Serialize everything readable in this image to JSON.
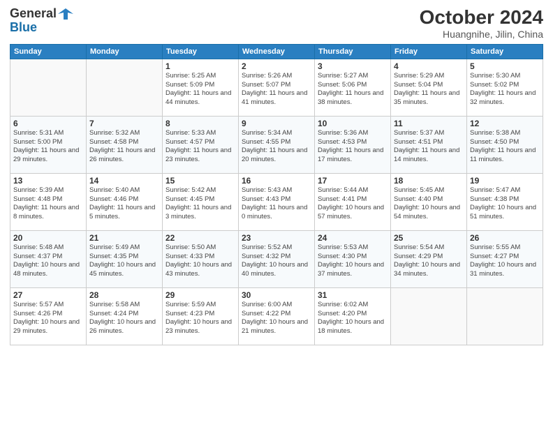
{
  "header": {
    "logo_general": "General",
    "logo_blue": "Blue",
    "month_title": "October 2024",
    "location": "Huangnihe, Jilin, China"
  },
  "weekdays": [
    "Sunday",
    "Monday",
    "Tuesday",
    "Wednesday",
    "Thursday",
    "Friday",
    "Saturday"
  ],
  "weeks": [
    [
      {
        "day": "",
        "info": ""
      },
      {
        "day": "",
        "info": ""
      },
      {
        "day": "1",
        "info": "Sunrise: 5:25 AM\nSunset: 5:09 PM\nDaylight: 11 hours and 44 minutes."
      },
      {
        "day": "2",
        "info": "Sunrise: 5:26 AM\nSunset: 5:07 PM\nDaylight: 11 hours and 41 minutes."
      },
      {
        "day": "3",
        "info": "Sunrise: 5:27 AM\nSunset: 5:06 PM\nDaylight: 11 hours and 38 minutes."
      },
      {
        "day": "4",
        "info": "Sunrise: 5:29 AM\nSunset: 5:04 PM\nDaylight: 11 hours and 35 minutes."
      },
      {
        "day": "5",
        "info": "Sunrise: 5:30 AM\nSunset: 5:02 PM\nDaylight: 11 hours and 32 minutes."
      }
    ],
    [
      {
        "day": "6",
        "info": "Sunrise: 5:31 AM\nSunset: 5:00 PM\nDaylight: 11 hours and 29 minutes."
      },
      {
        "day": "7",
        "info": "Sunrise: 5:32 AM\nSunset: 4:58 PM\nDaylight: 11 hours and 26 minutes."
      },
      {
        "day": "8",
        "info": "Sunrise: 5:33 AM\nSunset: 4:57 PM\nDaylight: 11 hours and 23 minutes."
      },
      {
        "day": "9",
        "info": "Sunrise: 5:34 AM\nSunset: 4:55 PM\nDaylight: 11 hours and 20 minutes."
      },
      {
        "day": "10",
        "info": "Sunrise: 5:36 AM\nSunset: 4:53 PM\nDaylight: 11 hours and 17 minutes."
      },
      {
        "day": "11",
        "info": "Sunrise: 5:37 AM\nSunset: 4:51 PM\nDaylight: 11 hours and 14 minutes."
      },
      {
        "day": "12",
        "info": "Sunrise: 5:38 AM\nSunset: 4:50 PM\nDaylight: 11 hours and 11 minutes."
      }
    ],
    [
      {
        "day": "13",
        "info": "Sunrise: 5:39 AM\nSunset: 4:48 PM\nDaylight: 11 hours and 8 minutes."
      },
      {
        "day": "14",
        "info": "Sunrise: 5:40 AM\nSunset: 4:46 PM\nDaylight: 11 hours and 5 minutes."
      },
      {
        "day": "15",
        "info": "Sunrise: 5:42 AM\nSunset: 4:45 PM\nDaylight: 11 hours and 3 minutes."
      },
      {
        "day": "16",
        "info": "Sunrise: 5:43 AM\nSunset: 4:43 PM\nDaylight: 11 hours and 0 minutes."
      },
      {
        "day": "17",
        "info": "Sunrise: 5:44 AM\nSunset: 4:41 PM\nDaylight: 10 hours and 57 minutes."
      },
      {
        "day": "18",
        "info": "Sunrise: 5:45 AM\nSunset: 4:40 PM\nDaylight: 10 hours and 54 minutes."
      },
      {
        "day": "19",
        "info": "Sunrise: 5:47 AM\nSunset: 4:38 PM\nDaylight: 10 hours and 51 minutes."
      }
    ],
    [
      {
        "day": "20",
        "info": "Sunrise: 5:48 AM\nSunset: 4:37 PM\nDaylight: 10 hours and 48 minutes."
      },
      {
        "day": "21",
        "info": "Sunrise: 5:49 AM\nSunset: 4:35 PM\nDaylight: 10 hours and 45 minutes."
      },
      {
        "day": "22",
        "info": "Sunrise: 5:50 AM\nSunset: 4:33 PM\nDaylight: 10 hours and 43 minutes."
      },
      {
        "day": "23",
        "info": "Sunrise: 5:52 AM\nSunset: 4:32 PM\nDaylight: 10 hours and 40 minutes."
      },
      {
        "day": "24",
        "info": "Sunrise: 5:53 AM\nSunset: 4:30 PM\nDaylight: 10 hours and 37 minutes."
      },
      {
        "day": "25",
        "info": "Sunrise: 5:54 AM\nSunset: 4:29 PM\nDaylight: 10 hours and 34 minutes."
      },
      {
        "day": "26",
        "info": "Sunrise: 5:55 AM\nSunset: 4:27 PM\nDaylight: 10 hours and 31 minutes."
      }
    ],
    [
      {
        "day": "27",
        "info": "Sunrise: 5:57 AM\nSunset: 4:26 PM\nDaylight: 10 hours and 29 minutes."
      },
      {
        "day": "28",
        "info": "Sunrise: 5:58 AM\nSunset: 4:24 PM\nDaylight: 10 hours and 26 minutes."
      },
      {
        "day": "29",
        "info": "Sunrise: 5:59 AM\nSunset: 4:23 PM\nDaylight: 10 hours and 23 minutes."
      },
      {
        "day": "30",
        "info": "Sunrise: 6:00 AM\nSunset: 4:22 PM\nDaylight: 10 hours and 21 minutes."
      },
      {
        "day": "31",
        "info": "Sunrise: 6:02 AM\nSunset: 4:20 PM\nDaylight: 10 hours and 18 minutes."
      },
      {
        "day": "",
        "info": ""
      },
      {
        "day": "",
        "info": ""
      }
    ]
  ]
}
